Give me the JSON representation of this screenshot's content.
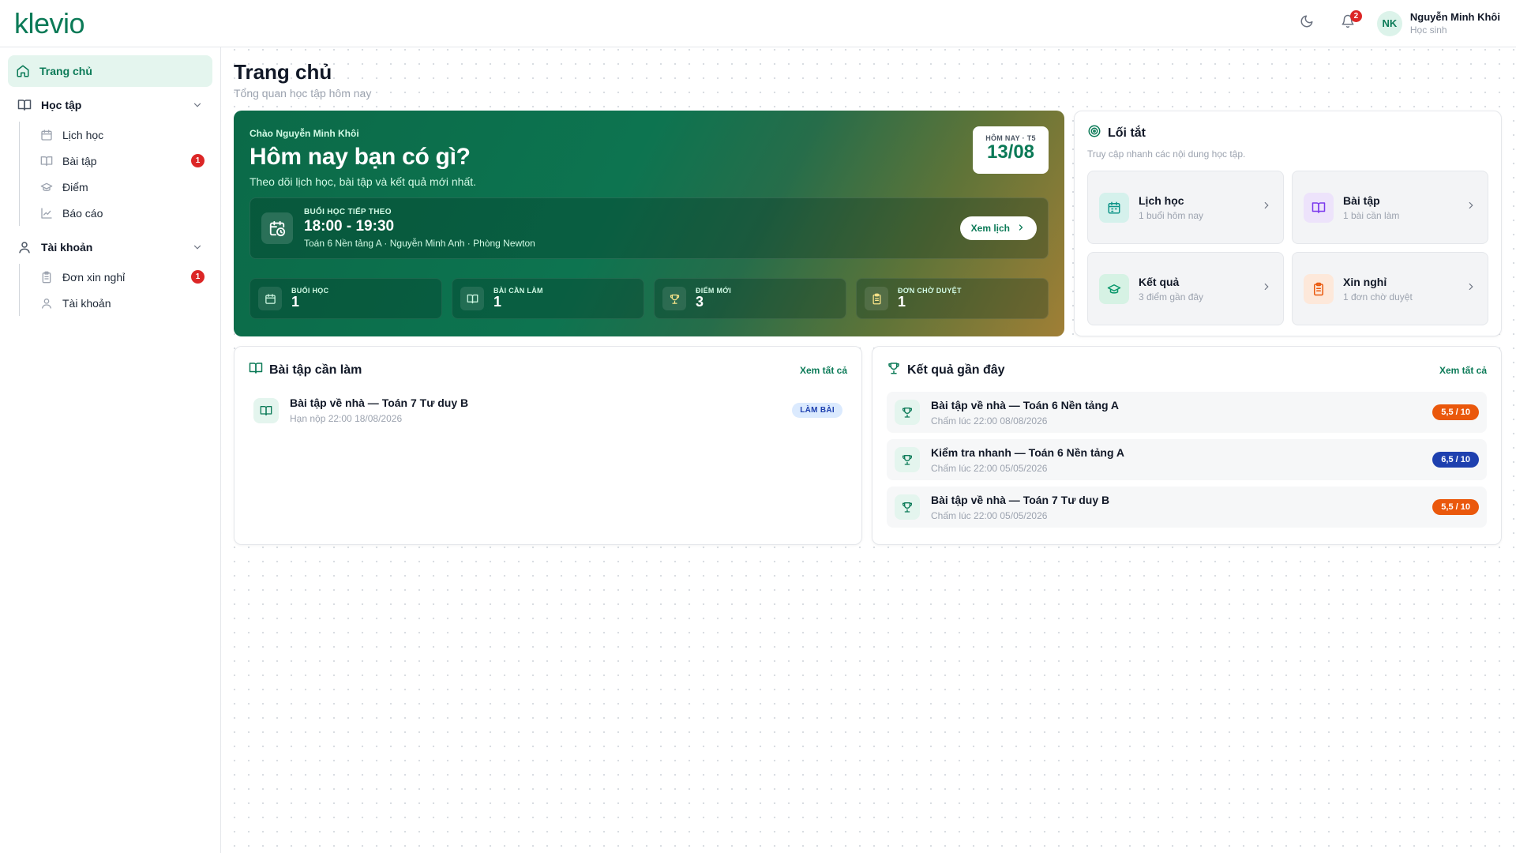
{
  "app": {
    "logo": "klevio"
  },
  "header": {
    "notification_count": "2",
    "user": {
      "initials": "NK",
      "name": "Nguyễn Minh Khôi",
      "role": "Học sinh"
    }
  },
  "sidebar": {
    "home": "Trang chủ",
    "group_study": {
      "label": "Học tập",
      "items": [
        {
          "label": "Lịch học",
          "icon": "calendar-icon",
          "badge": ""
        },
        {
          "label": "Bài tập",
          "icon": "book-icon",
          "badge": "1"
        },
        {
          "label": "Điểm",
          "icon": "graduation-cap-icon",
          "badge": ""
        },
        {
          "label": "Báo cáo",
          "icon": "line-chart-icon",
          "badge": ""
        }
      ]
    },
    "group_account": {
      "label": "Tài khoản",
      "items": [
        {
          "label": "Đơn xin nghỉ",
          "icon": "clipboard-icon",
          "badge": "1"
        },
        {
          "label": "Tài khoản",
          "icon": "user-icon",
          "badge": ""
        }
      ]
    }
  },
  "page": {
    "title": "Trang chủ",
    "subtitle": "Tổng quan học tập hôm nay"
  },
  "hero": {
    "greeting": "Chào Nguyễn Minh Khôi",
    "title": "Hôm nay bạn có gì?",
    "subtitle": "Theo dõi lịch học, bài tập và kết quả mới nhất.",
    "date_label": "HÔM NAY · T5",
    "date_value": "13/08",
    "next_session": {
      "label": "BUỔI HỌC TIẾP THEO",
      "time": "18:00 - 19:30",
      "detail": "Toán 6 Nền tảng A · Nguyễn Minh Anh · Phòng Newton",
      "button": "Xem lịch"
    },
    "stats": [
      {
        "label": "BUỔI HỌC",
        "value": "1",
        "icon": "calendar-icon"
      },
      {
        "label": "BÀI CẦN LÀM",
        "value": "1",
        "icon": "book-icon"
      },
      {
        "label": "ĐIỂM MỚI",
        "value": "3",
        "icon": "trophy-icon"
      },
      {
        "label": "ĐƠN CHỜ DUYỆT",
        "value": "1",
        "icon": "clipboard-icon"
      }
    ]
  },
  "shortcuts": {
    "title": "Lối tắt",
    "description": "Truy cập nhanh các nội dung học tập.",
    "items": [
      {
        "title": "Lịch học",
        "subtitle": "1 buổi hôm nay",
        "icon": "calendar-icon",
        "color": "#0d9488"
      },
      {
        "title": "Bài tập",
        "subtitle": "1 bài cần làm",
        "icon": "book-icon",
        "color": "#7c3aed"
      },
      {
        "title": "Kết quả",
        "subtitle": "3 điểm gần đây",
        "icon": "graduation-cap-icon",
        "color": "#059669"
      },
      {
        "title": "Xin nghỉ",
        "subtitle": "1 đơn chờ duyệt",
        "icon": "clipboard-icon",
        "color": "#ea580c"
      }
    ]
  },
  "todo": {
    "title": "Bài tập cần làm",
    "see_all": "Xem tất cả",
    "items": [
      {
        "title": "Bài tập về nhà — Toán 7 Tư duy B",
        "due": "Hạn nộp 22:00 18/08/2026",
        "action": "LÀM BÀI"
      }
    ]
  },
  "results": {
    "title": "Kết quả gần đây",
    "see_all": "Xem tất cả",
    "items": [
      {
        "title": "Bài tập về nhà — Toán 6 Nền tảng A",
        "graded": "Chấm lúc 22:00 08/08/2026",
        "score": "5,5 / 10",
        "color": "#ea580c"
      },
      {
        "title": "Kiểm tra nhanh — Toán 6 Nền tảng A",
        "graded": "Chấm lúc 22:00 05/05/2026",
        "score": "6,5 / 10",
        "color": "#1e40af"
      },
      {
        "title": "Bài tập về nhà — Toán 7 Tư duy B",
        "graded": "Chấm lúc 22:00 05/05/2026",
        "score": "5,5 / 10",
        "color": "#ea580c"
      }
    ]
  }
}
